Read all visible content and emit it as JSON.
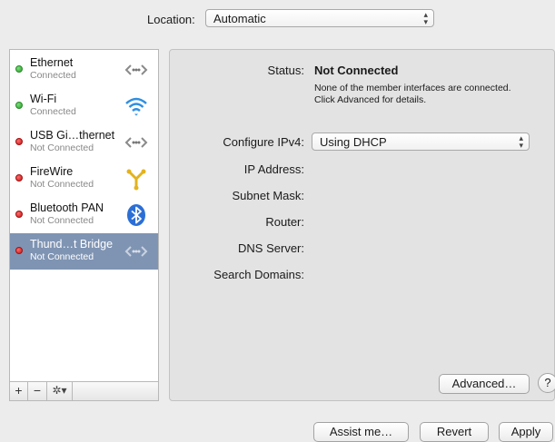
{
  "location": {
    "label": "Location:",
    "value": "Automatic"
  },
  "services": [
    {
      "name": "Ethernet",
      "status": "Connected",
      "state": "green",
      "icon": "ethernet-icon"
    },
    {
      "name": "Wi-Fi",
      "status": "Connected",
      "state": "green",
      "icon": "wifi-icon"
    },
    {
      "name": "USB Gi…thernet",
      "status": "Not Connected",
      "state": "red",
      "icon": "ethernet-icon"
    },
    {
      "name": "FireWire",
      "status": "Not Connected",
      "state": "red",
      "icon": "firewire-icon"
    },
    {
      "name": "Bluetooth PAN",
      "status": "Not Connected",
      "state": "red",
      "icon": "bluetooth-icon"
    },
    {
      "name": "Thund…t Bridge",
      "status": "Not Connected",
      "state": "red",
      "icon": "ethernet-icon",
      "selected": true
    }
  ],
  "toolbar": {
    "add": "+",
    "remove": "−",
    "gear": "✲▾"
  },
  "detail": {
    "status_label": "Status:",
    "status_value": "Not Connected",
    "status_desc": "None of the member interfaces are connected. Click Advanced for details.",
    "configure_label": "Configure IPv4:",
    "configure_value": "Using DHCP",
    "ip_label": "IP Address:",
    "subnet_label": "Subnet Mask:",
    "router_label": "Router:",
    "dns_label": "DNS Server:",
    "search_label": "Search Domains:",
    "advanced": "Advanced…",
    "help": "?"
  },
  "buttons": {
    "assist": "Assist me…",
    "revert": "Revert",
    "apply": "Apply"
  },
  "colors": {
    "selected_row": "#7f94b3",
    "connected": "#2e9c2e",
    "disconnected": "#c21818"
  }
}
